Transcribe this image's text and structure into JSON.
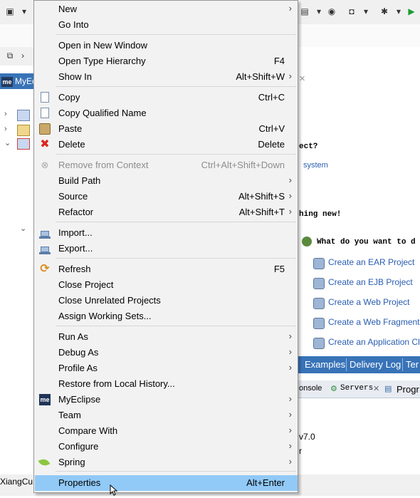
{
  "bottom_left_status": "XiangCu",
  "left_tab": {
    "label": "MyEc"
  },
  "welcome": {
    "text_lines": [
      "ect?",
      "hing new!",
      "What do you want to d"
    ],
    "system_link": "system",
    "links": [
      "Create an EAR Project",
      "Create an EJB Project",
      "Create a Web Project",
      "Create a Web Fragment Pro",
      "Create an Application Client"
    ]
  },
  "bottom_tabs": [
    "Examples",
    "Delivery Log",
    "Ter"
  ],
  "console_tabs": {
    "console": "onsole",
    "servers": "Servers",
    "progress": "Progr"
  },
  "bottom_fragments": [
    "v7.0",
    "r"
  ],
  "context_menu": {
    "items": [
      {
        "label": "New",
        "shortcut": "",
        "submenu": true,
        "icon": ""
      },
      {
        "label": "Go Into",
        "shortcut": "",
        "submenu": false,
        "icon": ""
      },
      {
        "label": "Open in New Window",
        "shortcut": "",
        "submenu": false,
        "icon": ""
      },
      {
        "label": "Open Type Hierarchy",
        "shortcut": "F4",
        "submenu": false,
        "icon": ""
      },
      {
        "label": "Show In",
        "shortcut": "Alt+Shift+W",
        "submenu": true,
        "icon": ""
      },
      {
        "label": "Copy",
        "shortcut": "Ctrl+C",
        "submenu": false,
        "icon": "copy-icon"
      },
      {
        "label": "Copy Qualified Name",
        "shortcut": "",
        "submenu": false,
        "icon": "copy-qualified-icon"
      },
      {
        "label": "Paste",
        "shortcut": "Ctrl+V",
        "submenu": false,
        "icon": "paste-icon"
      },
      {
        "label": "Delete",
        "shortcut": "Delete",
        "submenu": false,
        "icon": "delete-icon"
      },
      {
        "label": "Remove from Context",
        "shortcut": "Ctrl+Alt+Shift+Down",
        "submenu": false,
        "disabled": true,
        "icon": "remove-context-icon"
      },
      {
        "label": "Build Path",
        "shortcut": "",
        "submenu": true,
        "icon": ""
      },
      {
        "label": "Source",
        "shortcut": "Alt+Shift+S",
        "submenu": true,
        "icon": ""
      },
      {
        "label": "Refactor",
        "shortcut": "Alt+Shift+T",
        "submenu": true,
        "icon": ""
      },
      {
        "label": "Import...",
        "shortcut": "",
        "submenu": false,
        "icon": "import-icon"
      },
      {
        "label": "Export...",
        "shortcut": "",
        "submenu": false,
        "icon": "export-icon"
      },
      {
        "label": "Refresh",
        "shortcut": "F5",
        "submenu": false,
        "icon": "refresh-icon"
      },
      {
        "label": "Close Project",
        "shortcut": "",
        "submenu": false,
        "icon": ""
      },
      {
        "label": "Close Unrelated Projects",
        "shortcut": "",
        "submenu": false,
        "icon": ""
      },
      {
        "label": "Assign Working Sets...",
        "shortcut": "",
        "submenu": false,
        "icon": ""
      },
      {
        "label": "Run As",
        "shortcut": "",
        "submenu": true,
        "icon": ""
      },
      {
        "label": "Debug As",
        "shortcut": "",
        "submenu": true,
        "icon": ""
      },
      {
        "label": "Profile As",
        "shortcut": "",
        "submenu": true,
        "icon": ""
      },
      {
        "label": "Restore from Local History...",
        "shortcut": "",
        "submenu": false,
        "icon": ""
      },
      {
        "label": "MyEclipse",
        "shortcut": "",
        "submenu": true,
        "icon": "myeclipse-icon"
      },
      {
        "label": "Team",
        "shortcut": "",
        "submenu": true,
        "icon": ""
      },
      {
        "label": "Compare With",
        "shortcut": "",
        "submenu": true,
        "icon": ""
      },
      {
        "label": "Configure",
        "shortcut": "",
        "submenu": true,
        "icon": ""
      },
      {
        "label": "Spring",
        "shortcut": "",
        "submenu": true,
        "icon": "spring-leaf-icon"
      },
      {
        "label": "Properties",
        "shortcut": "Alt+Enter",
        "submenu": false,
        "selected": true,
        "icon": ""
      }
    ],
    "me_badge": "me",
    "submenu_arrow": "›"
  }
}
